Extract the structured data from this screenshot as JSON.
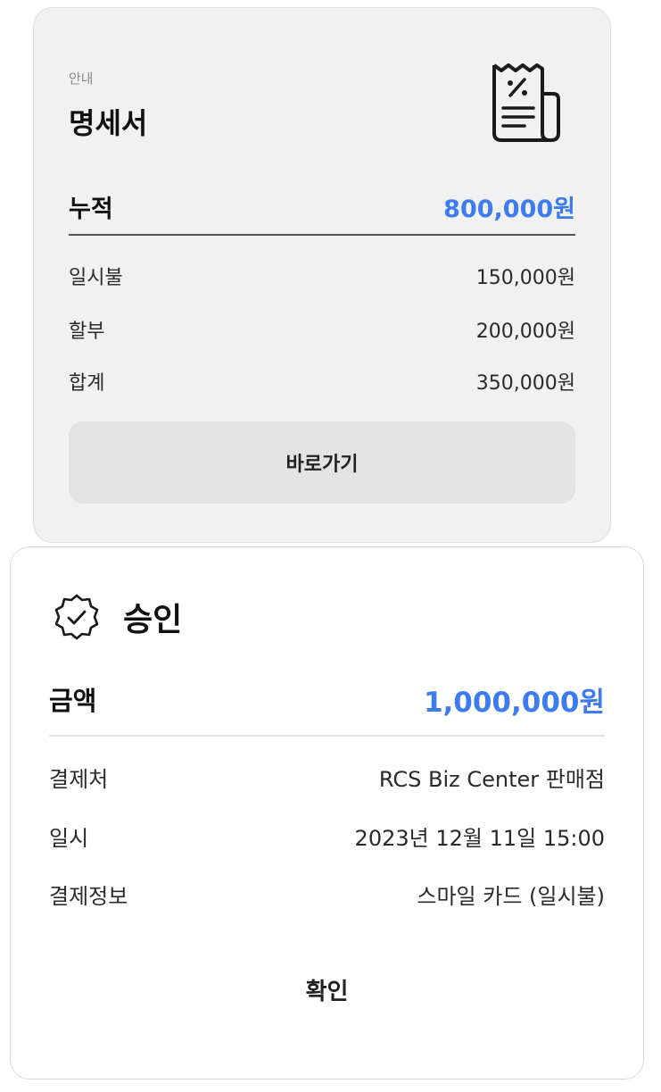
{
  "statement_card": {
    "caption": "안내",
    "title": "명세서",
    "icon": "receipt-percent-icon",
    "total": {
      "label": "누적",
      "value": "800,000원"
    },
    "items": [
      {
        "label": "일시불",
        "value": "150,000원"
      },
      {
        "label": "할부",
        "value": "200,000원"
      },
      {
        "label": "합계",
        "value": "350,000원"
      }
    ],
    "button_label": "바로가기"
  },
  "approval_card": {
    "icon": "verified-badge-check-icon",
    "title": "승인",
    "total": {
      "label": "금액",
      "value": "1,000,000원"
    },
    "items": [
      {
        "label": "결제처",
        "value": "RCS Biz Center 판매점"
      },
      {
        "label": "일시",
        "value": "2023년 12월 11일 15:00"
      },
      {
        "label": "결제정보",
        "value": "스마일 카드 (일시불)"
      }
    ],
    "button_label": "확인"
  },
  "colors": {
    "accent": "#3d7bf0",
    "card1_bg": "#f1f1f1",
    "button_bg": "#e3e3e3"
  }
}
